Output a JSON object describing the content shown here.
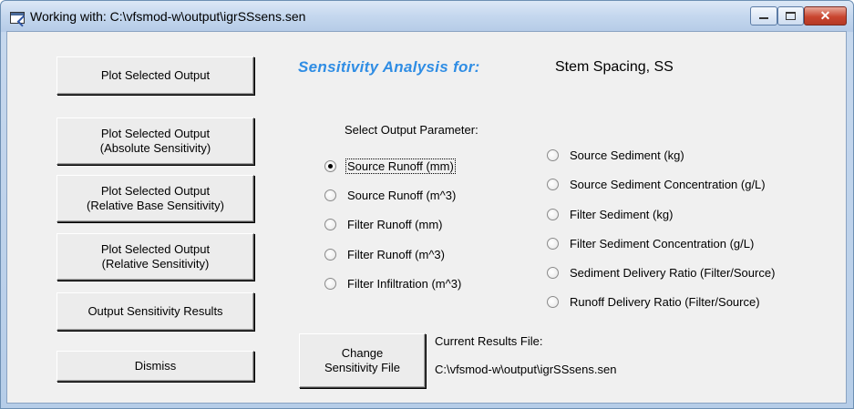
{
  "window": {
    "title": "Working with: C:\\vfsmod-w\\output\\igrSSsens.sen",
    "close_glyph": "✕"
  },
  "buttons": {
    "plot_selected": "Plot Selected Output",
    "plot_absolute": "Plot Selected Output\n(Absolute Sensitivity)",
    "plot_relative_base": "Plot Selected Output\n(Relative Base Sensitivity)",
    "plot_relative": "Plot Selected Output\n(Relative Sensitivity)",
    "output_results": "Output Sensitivity Results",
    "dismiss": "Dismiss",
    "change_file": "Change\nSensitivity File"
  },
  "header": {
    "heading": "Sensitivity Analysis for:",
    "parameter": "Stem Spacing, SS"
  },
  "select_label": "Select Output Parameter:",
  "options_left": [
    {
      "label": "Source Runoff (mm)",
      "selected": true
    },
    {
      "label": "Source Runoff (m^3)",
      "selected": false
    },
    {
      "label": "Filter Runoff (mm)",
      "selected": false
    },
    {
      "label": "Filter Runoff (m^3)",
      "selected": false
    },
    {
      "label": "Filter Infiltration (m^3)",
      "selected": false
    }
  ],
  "options_right": [
    {
      "label": "Source Sediment (kg)",
      "selected": false
    },
    {
      "label": "Source Sediment Concentration  (g/L)",
      "selected": false
    },
    {
      "label": "Filter Sediment (kg)",
      "selected": false
    },
    {
      "label": "Filter Sediment Concentration (g/L)",
      "selected": false
    },
    {
      "label": "Sediment Delivery Ratio (Filter/Source)",
      "selected": false
    },
    {
      "label": "Runoff Delivery Ratio (Filter/Source)",
      "selected": false
    }
  ],
  "results_file": {
    "label": "Current Results File:",
    "path": "C:\\vfsmod-w\\output\\igrSSsens.sen"
  }
}
